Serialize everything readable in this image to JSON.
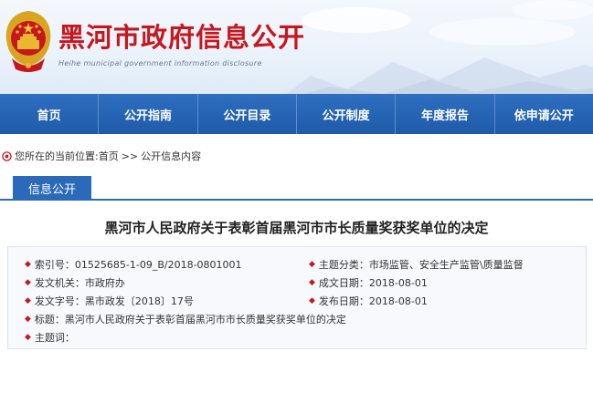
{
  "site": {
    "title": "黑河市政府信息公开",
    "subtitle": "Heihe municipal government information disclosure"
  },
  "nav": {
    "items": [
      {
        "label": "首页"
      },
      {
        "label": "公开指南"
      },
      {
        "label": "公开目录"
      },
      {
        "label": "公开制度"
      },
      {
        "label": "年度报告"
      },
      {
        "label": "依申请公开"
      }
    ]
  },
  "breadcrumb": {
    "prefix": "您所在的当前位置:",
    "home": "首页",
    "separator": ">>",
    "current": "公开信息内容"
  },
  "section": {
    "tab_label": "信息公开"
  },
  "document": {
    "title": "黑河市人民政府关于表彰首届黑河市市长质量奖获奖单位的决定",
    "meta": {
      "index_no": {
        "label": "索引号：",
        "value": "01525685-1-09_B/2018-0801001"
      },
      "category": {
        "label": "主题分类：",
        "value": "市场监管、安全生产监管\\质量监督"
      },
      "issuer": {
        "label": "发文机关：",
        "value": "市政府办"
      },
      "created": {
        "label": "成文日期：",
        "value": "2018-08-01"
      },
      "doc_no": {
        "label": "发文字号：",
        "value": "黑市政发〔2018〕17号"
      },
      "published": {
        "label": "发布日期：",
        "value": "2018-08-01"
      },
      "title": {
        "label": "标题：",
        "value": "黑河市人民政府关于表彰首届黑河市市长质量奖获奖单位的决定"
      },
      "keywords": {
        "label": "主题词：",
        "value": ""
      }
    }
  },
  "colors": {
    "brand_red": "#c8161d",
    "nav_blue": "#1e5aa8",
    "tab_blue": "#2a6ab8"
  }
}
